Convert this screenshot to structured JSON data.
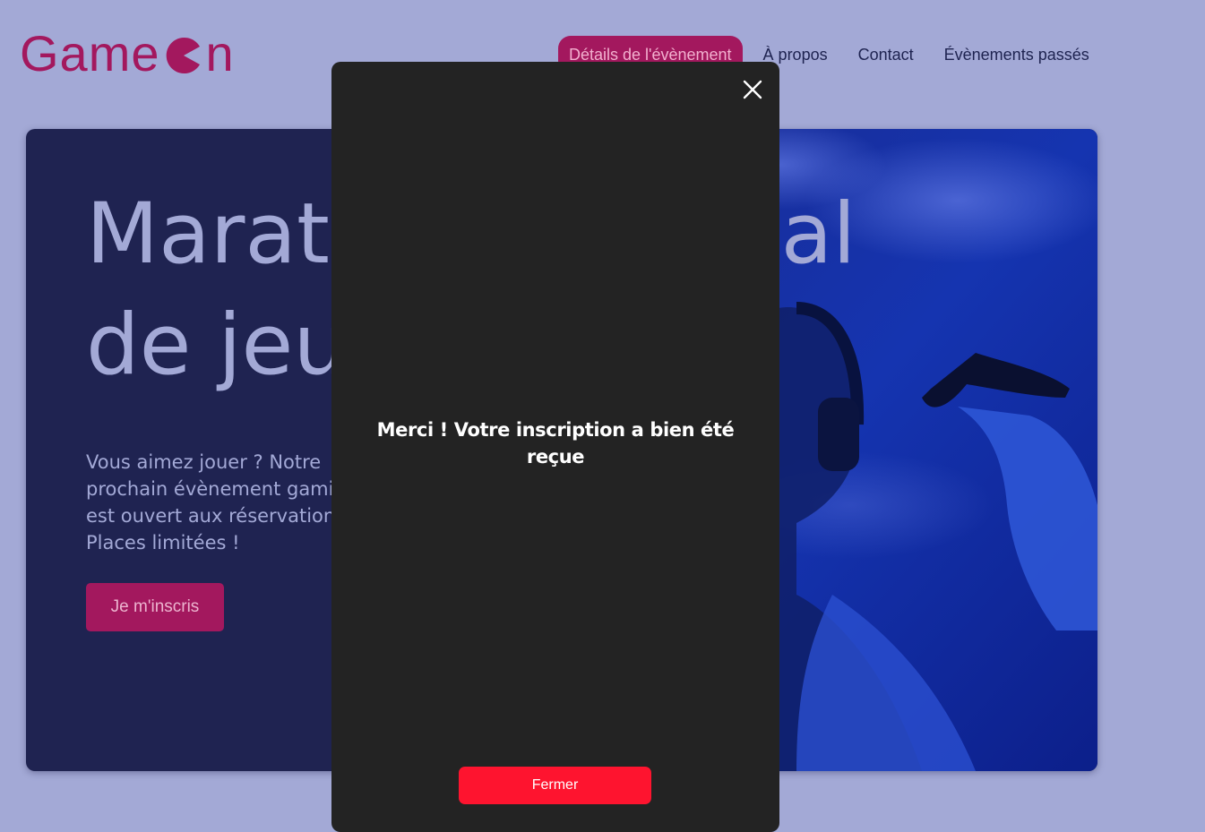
{
  "header": {
    "logo_text_start": "Game",
    "logo_text_end": "n",
    "logo_icon": "pacman-o-icon",
    "nav": [
      {
        "label": "Détails de l'évènement",
        "active": true
      },
      {
        "label": "À propos"
      },
      {
        "label": "Contact"
      },
      {
        "label": "Évènements passés"
      }
    ]
  },
  "hero": {
    "title_line1": "Marathon national",
    "title_line2": "de jeux vidéos",
    "text": "Vous aimez jouer ? Notre prochain évènement gaming est ouvert aux réservations... Places limitées !",
    "cta_label": "Je m'inscris",
    "image": "person-holding-game-controller-photo"
  },
  "modal": {
    "close_icon": "close-icon",
    "message": "Merci ! Votre inscription a bien été reçue",
    "close_button_label": "Fermer"
  },
  "colors": {
    "page_background": "#a3a9d6",
    "brand": "#a3185e",
    "hero_background": "#1f2351",
    "modal_background": "#232323",
    "modal_button": "#fe142f"
  }
}
